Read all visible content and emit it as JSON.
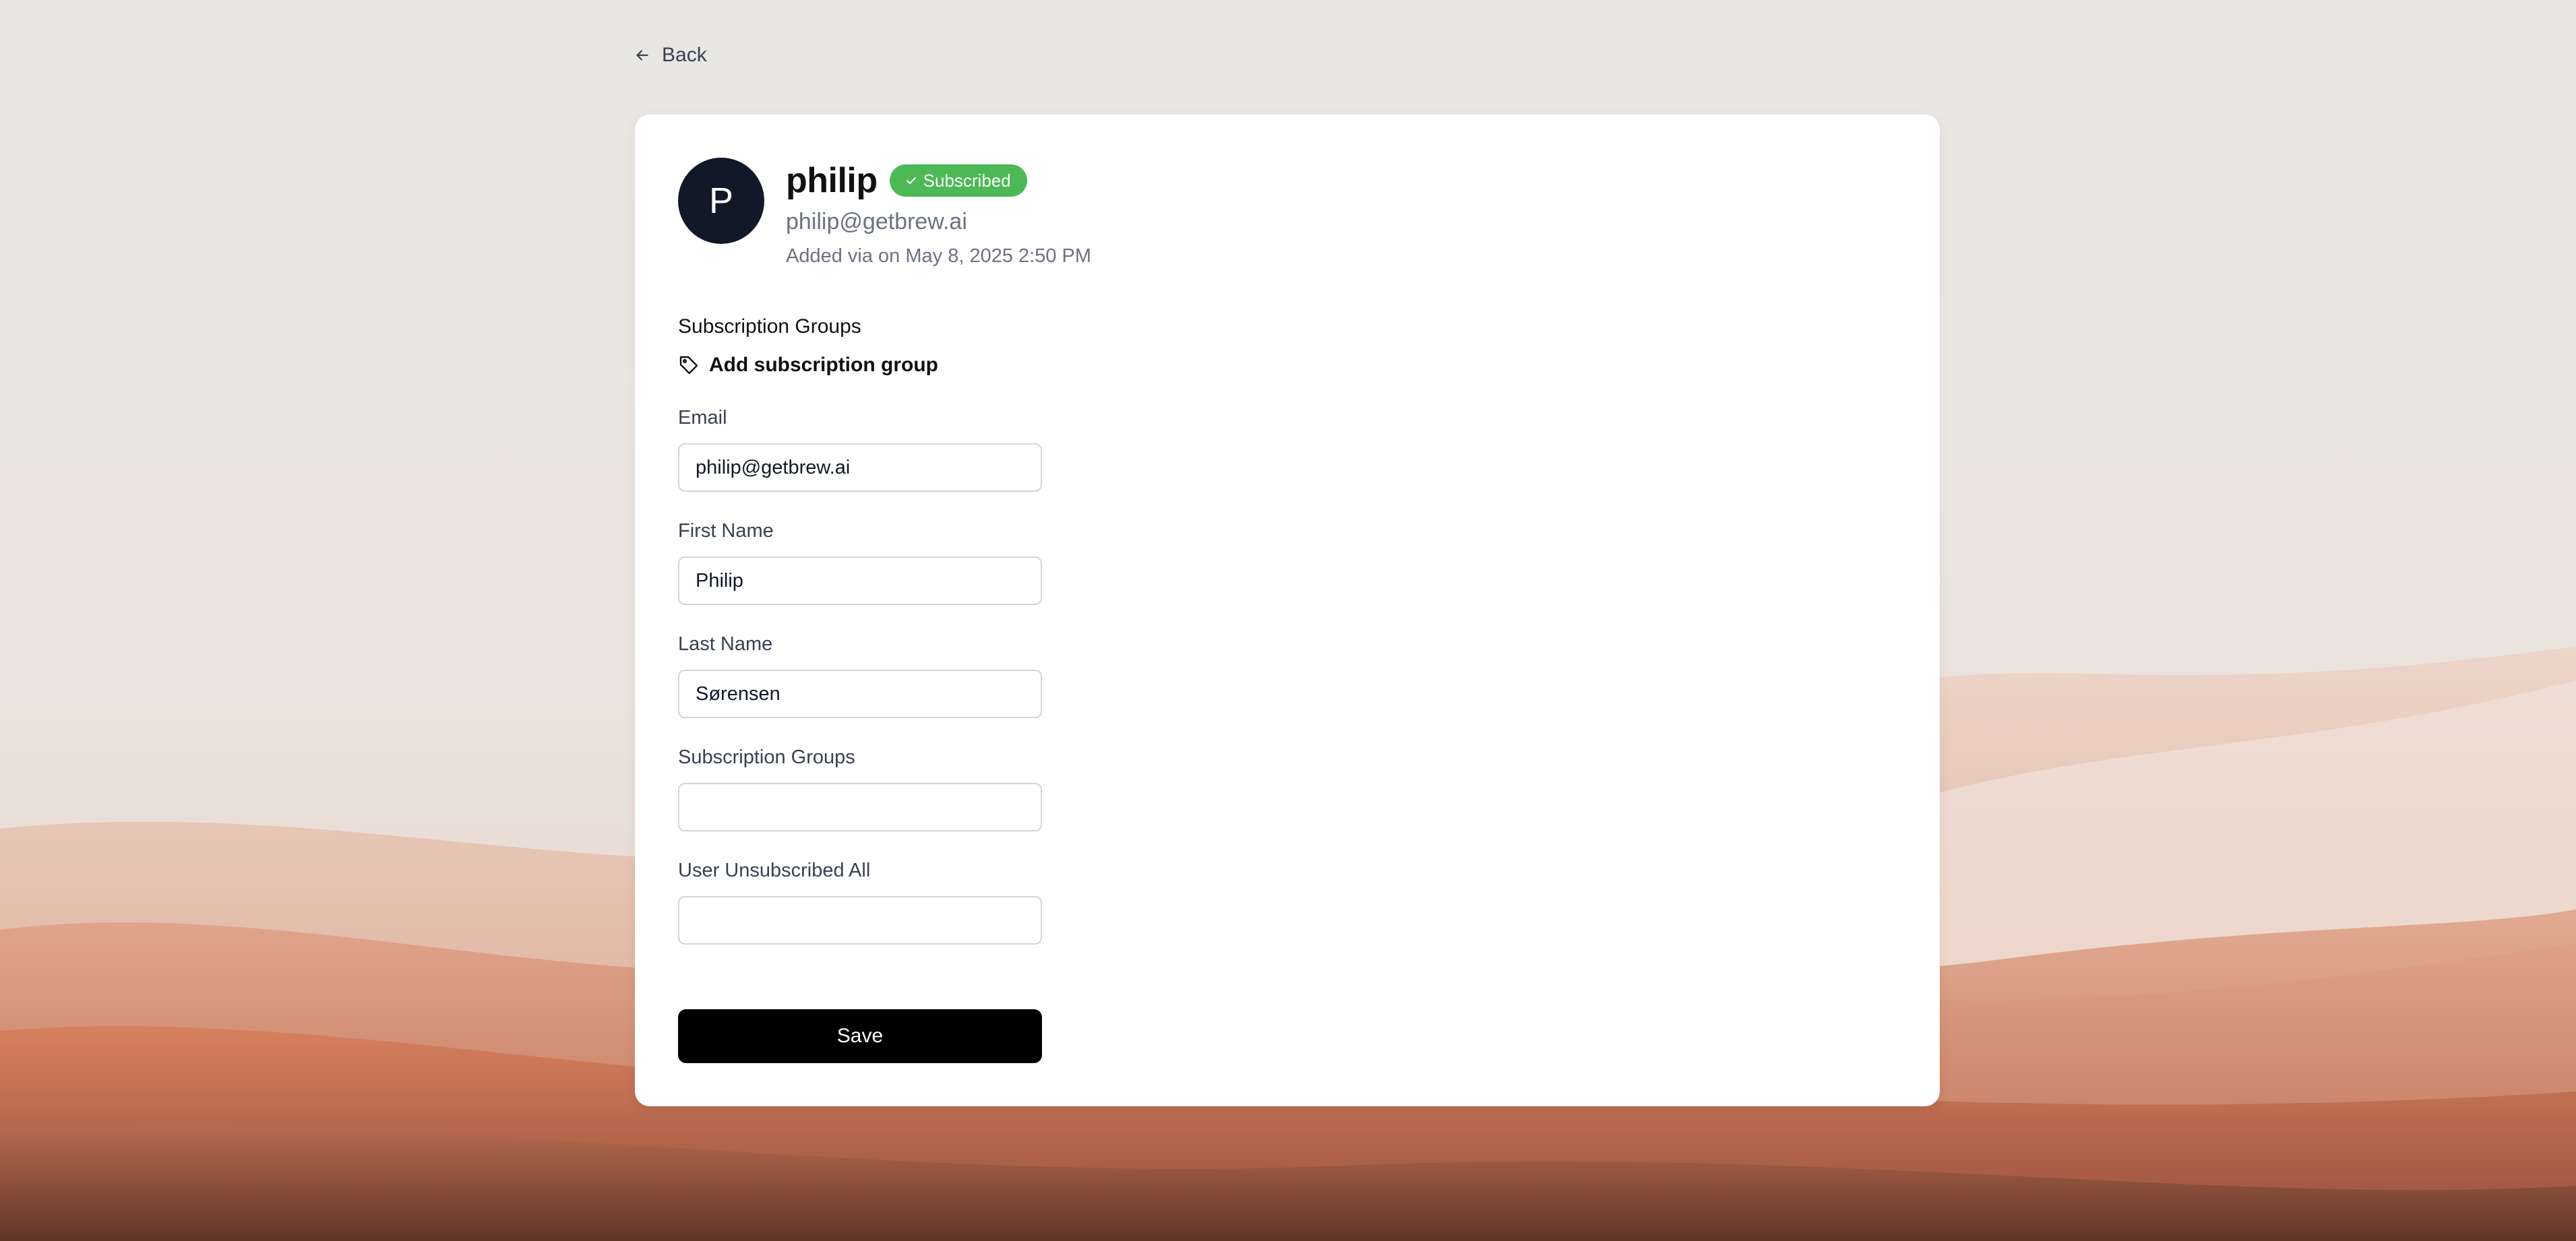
{
  "nav": {
    "back_label": "Back",
    "back_icon": "arrow-left-icon"
  },
  "contact": {
    "avatar_initial": "P",
    "name": "philip",
    "status": "Subscribed",
    "status_icon": "check-icon",
    "email": "philip@getbrew.ai",
    "added_meta": "Added via on May 8, 2025 2:50 PM"
  },
  "subscription_groups": {
    "heading": "Subscription Groups",
    "add_label": "Add subscription group",
    "add_icon": "tag-icon"
  },
  "form": {
    "fields": [
      {
        "label": "Email",
        "value": "philip@getbrew.ai"
      },
      {
        "label": "First Name",
        "value": "Philip"
      },
      {
        "label": "Last Name",
        "value": "Sørensen"
      },
      {
        "label": "Subscription Groups",
        "value": ""
      },
      {
        "label": "User Unsubscribed All",
        "value": ""
      }
    ],
    "save_label": "Save"
  },
  "colors": {
    "page_background": "#e9e7e3",
    "badge_green": "#4cb856",
    "avatar_bg": "#111827",
    "button_bg": "#000000"
  }
}
